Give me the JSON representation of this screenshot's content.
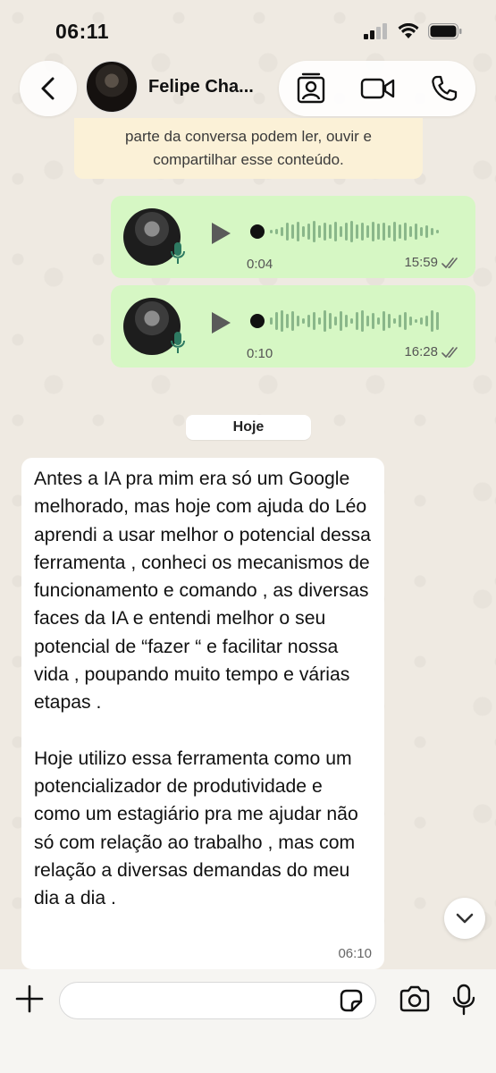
{
  "status": {
    "time": "06:11"
  },
  "header": {
    "back_icon": "chevron-left-icon",
    "contact_name": "Felipe Cha...",
    "actions": [
      "contact-card-icon",
      "video-icon",
      "phone-icon"
    ]
  },
  "chat": {
    "notice": [
      "parte da conversa podem ler, ouvir e",
      "compartilhar esse conteúdo."
    ],
    "voice_messages": [
      {
        "duration": "0:04",
        "time": "15:59",
        "status": "read"
      },
      {
        "duration": "0:10",
        "time": "16:28",
        "status": "read"
      }
    ],
    "date_chip": "Hoje",
    "message": {
      "paragraph1": "Antes a IA pra mim era só um Google melhorado, mas hoje com ajuda do Léo aprendi a usar melhor o potencial dessa ferramenta , conheci os mecanismos de funcionamento e comando , as diversas faces da IA e entendi melhor o seu potencial de “fazer “ e facilitar nossa vida , poupando muito tempo e várias etapas .",
      "paragraph2": "Hoje utilizo essa ferramenta como um potencializador de produtividade e como um estagiário pra me ajudar não só com relação ao trabalho , mas com relação a diversas demandas do meu dia a dia .",
      "time": "06:10"
    }
  },
  "input": {
    "placeholder": "",
    "value": ""
  },
  "colors": {
    "bubble_out": "#d6f7c4",
    "bubble_in": "#ffffff",
    "notice": "#fbf1d7"
  }
}
